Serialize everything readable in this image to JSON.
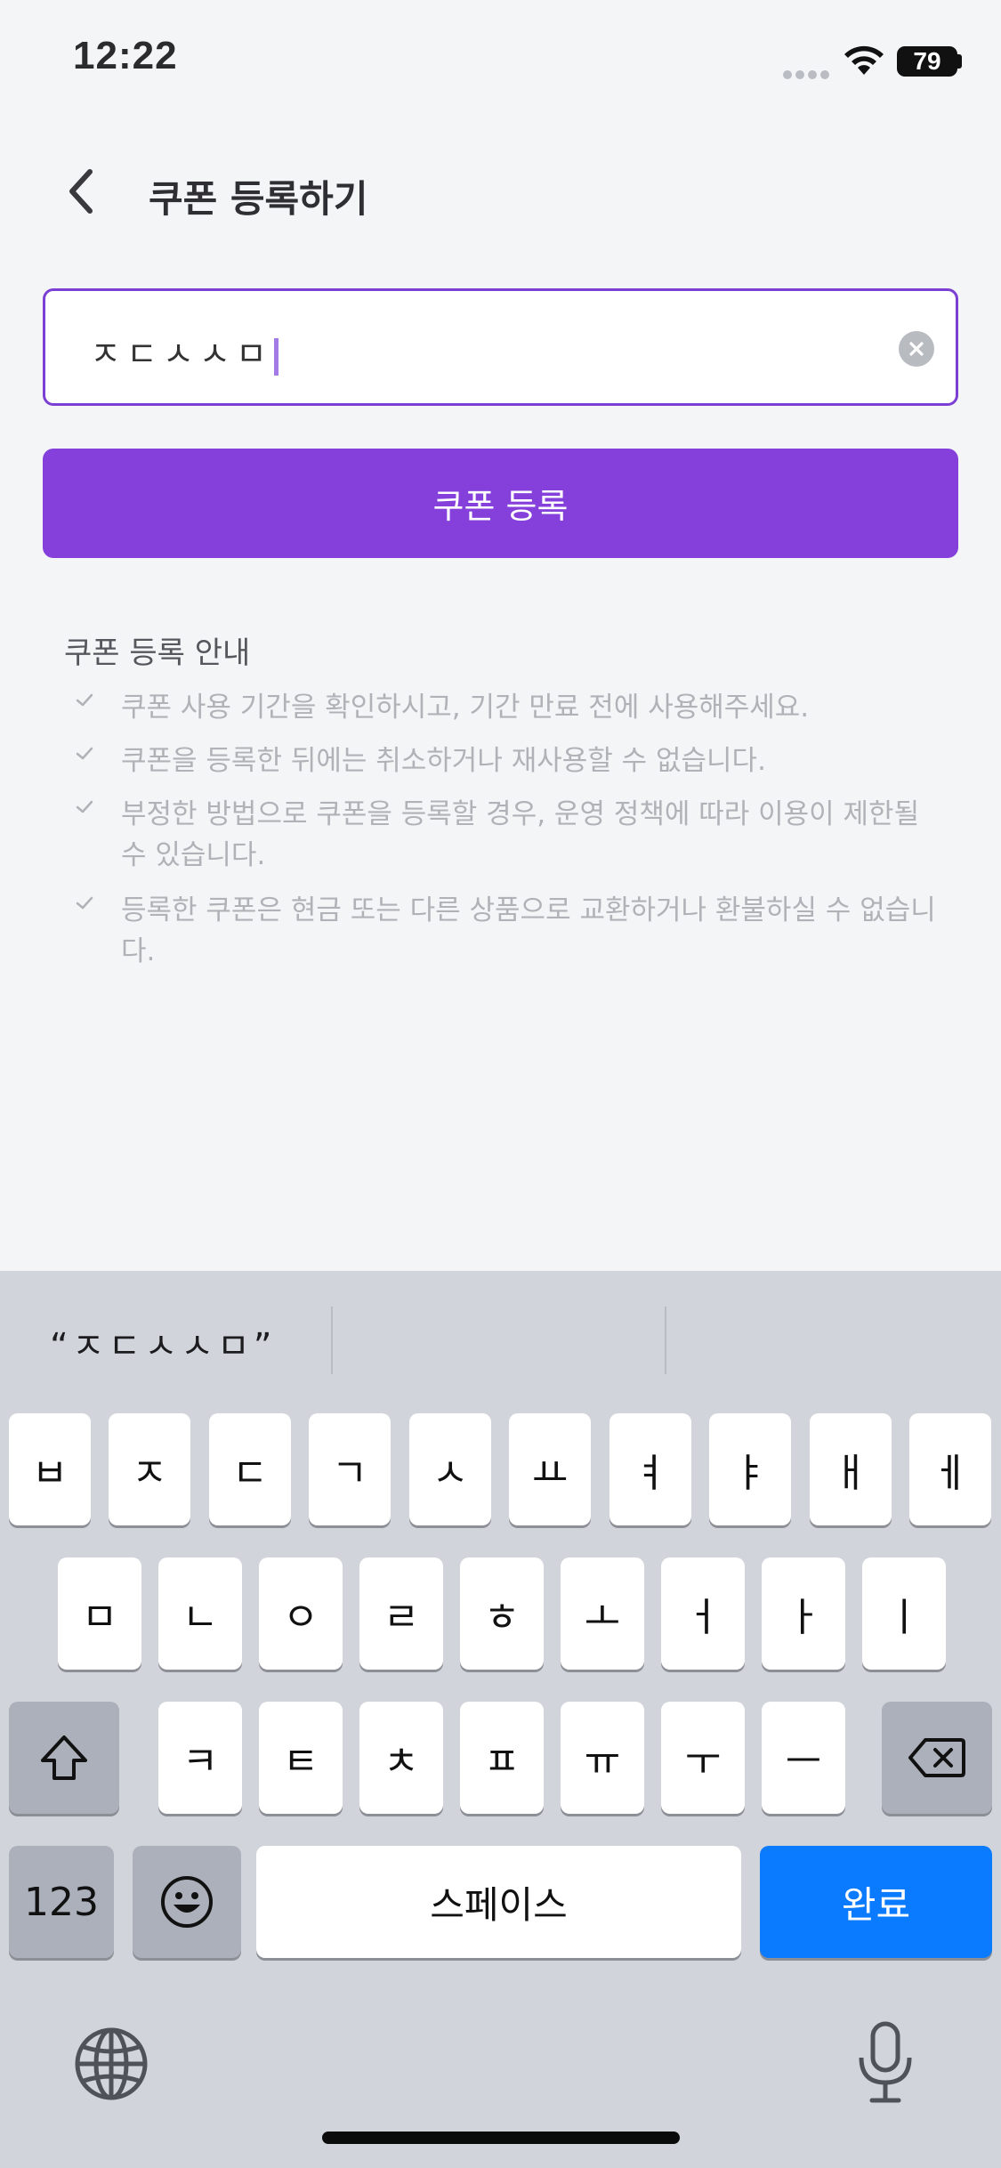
{
  "status_bar": {
    "time": "12:22",
    "battery": "79"
  },
  "header": {
    "title": "쿠폰 등록하기"
  },
  "coupon_input": {
    "value": "ㅈㄷㅅㅅㅁ"
  },
  "register_button": {
    "label": "쿠폰 등록"
  },
  "notice": {
    "title": "쿠폰 등록 안내",
    "items": [
      {
        "text": "쿠폰 사용 기간을 확인하시고, 기간 만료 전에 사용해주세요."
      },
      {
        "text": "쿠폰을 등록한 뒤에는 취소하거나 재사용할 수 없습니다."
      },
      {
        "text": "부정한 방법으로 쿠폰을 등록할 경우, 운영 정책에 따라 이용이 제한될 수 있습니다."
      },
      {
        "text": "등록한 쿠폰은 현금 또는 다른 상품으로 교환하거나 환불하실 수 없습니다."
      }
    ]
  },
  "keyboard": {
    "suggestion": "“ㅈㄷㅅㅅㅁ”",
    "row1": [
      "ㅂ",
      "ㅈ",
      "ㄷ",
      "ㄱ",
      "ㅅ",
      "ㅛ",
      "ㅕ",
      "ㅑ",
      "ㅐ",
      "ㅔ"
    ],
    "row2": [
      "ㅁ",
      "ㄴ",
      "ㅇ",
      "ㄹ",
      "ㅎ",
      "ㅗ",
      "ㅓ",
      "ㅏ",
      "ㅣ"
    ],
    "row3": [
      "ㅋ",
      "ㅌ",
      "ㅊ",
      "ㅍ",
      "ㅠ",
      "ㅜ",
      "ㅡ"
    ],
    "numbers_label": "123",
    "space_label": "스페이스",
    "done_label": "완료"
  },
  "colors": {
    "accent": "#853fdb",
    "input_border": "#7b3fd3",
    "keyboard_bg": "#d1d4da",
    "done_key": "#0a7aff"
  },
  "icons": [
    "back-chevron-icon",
    "wifi-icon",
    "clear-icon",
    "check-icon",
    "shift-icon",
    "backspace-icon",
    "emoji-icon",
    "globe-icon",
    "microphone-icon"
  ]
}
